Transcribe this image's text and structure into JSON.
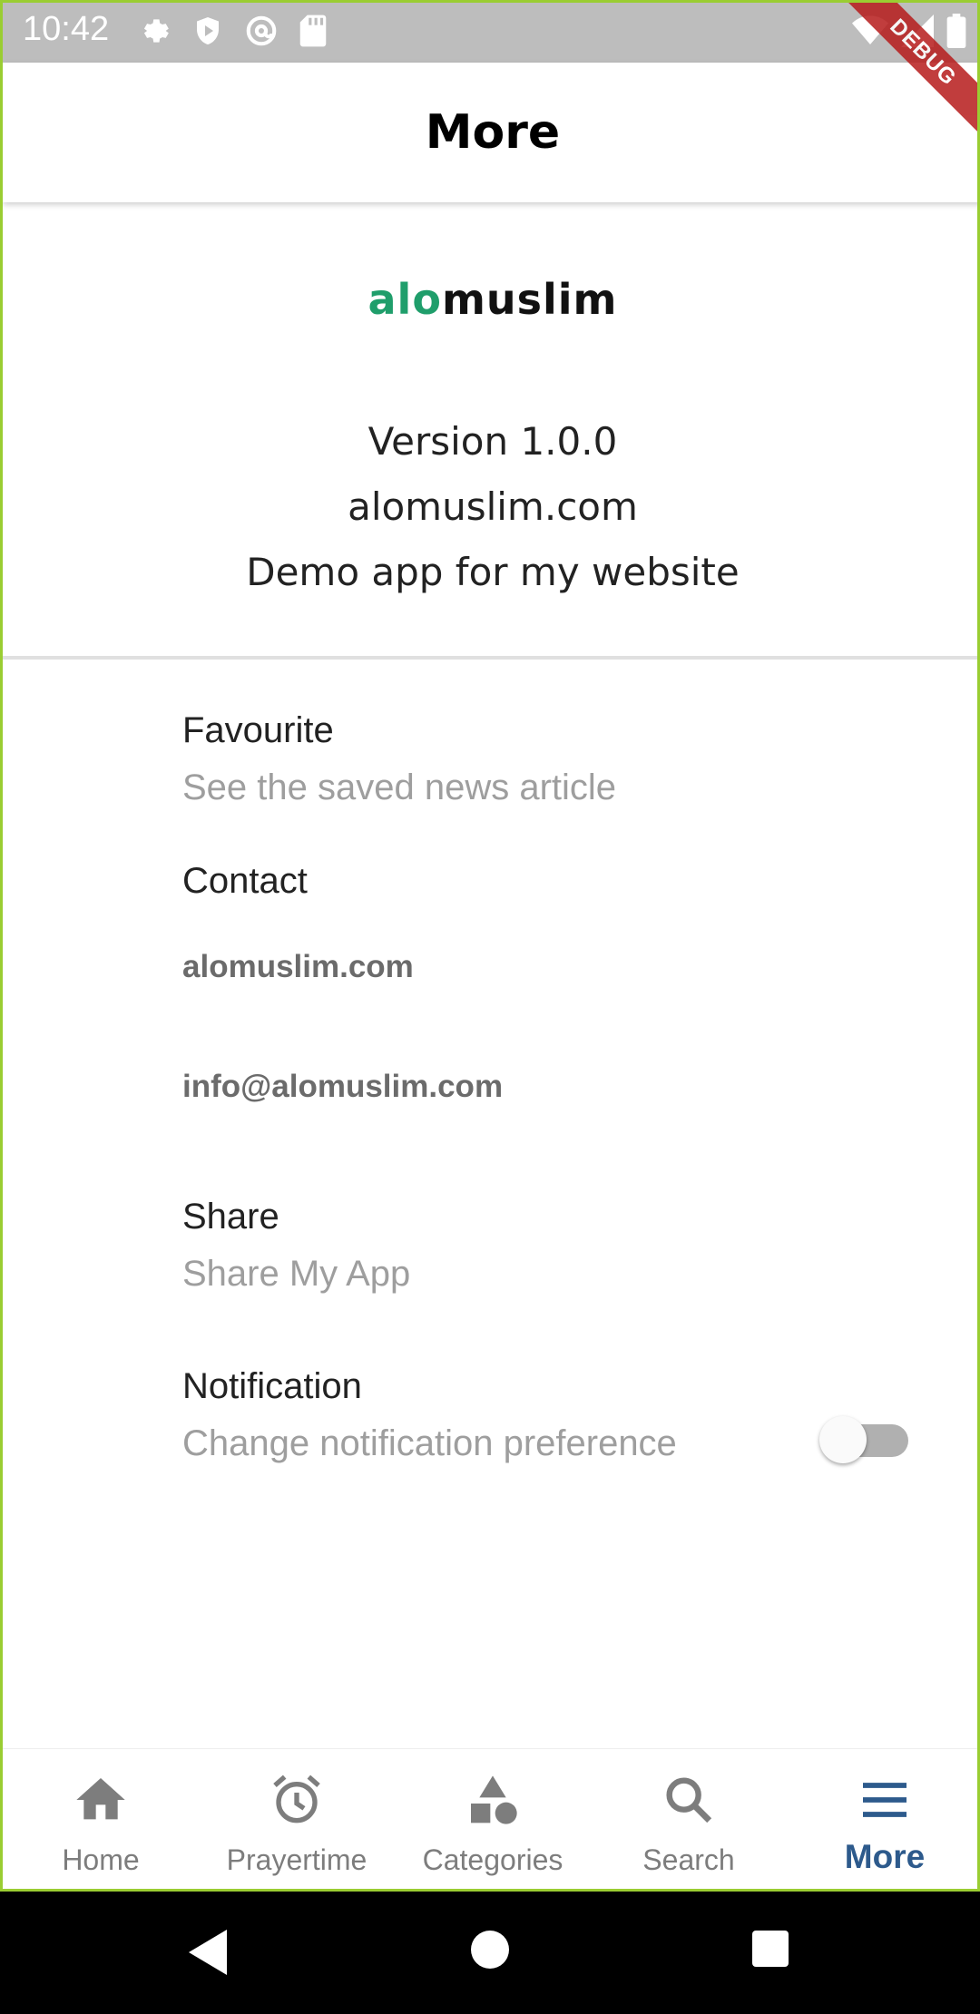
{
  "status_bar": {
    "time": "10:42",
    "icons": [
      "settings-icon",
      "shield-icon",
      "at-sign-icon",
      "sd-card-icon",
      "wifi-icon",
      "signal-icon",
      "battery-icon"
    ]
  },
  "debug_banner": "DEBUG",
  "app_bar": {
    "title": "More"
  },
  "header": {
    "logo_part1": "alo",
    "logo_part2": "muslim",
    "version": "Version 1.0.0",
    "website": "alomuslim.com",
    "description": "Demo app for my website"
  },
  "list": {
    "favourite": {
      "title": "Favourite",
      "subtitle": "See the saved news article"
    },
    "contact": {
      "title": "Contact",
      "website": "alomuslim.com",
      "email": "info@alomuslim.com"
    },
    "share": {
      "title": "Share",
      "subtitle": "Share My App"
    },
    "notification": {
      "title": "Notification",
      "subtitle": "Change notification preference",
      "enabled": false
    }
  },
  "bottom_nav": {
    "items": [
      {
        "label": "Home",
        "icon": "home-icon"
      },
      {
        "label": "Prayertime",
        "icon": "alarm-icon"
      },
      {
        "label": "Categories",
        "icon": "categories-icon"
      },
      {
        "label": "Search",
        "icon": "search-icon"
      },
      {
        "label": "More",
        "icon": "menu-icon"
      }
    ],
    "active": "More"
  },
  "colors": {
    "brand_green": "#1f9e6b",
    "active_nav": "#2d5a8c",
    "inactive_nav": "#7d7d7d"
  }
}
